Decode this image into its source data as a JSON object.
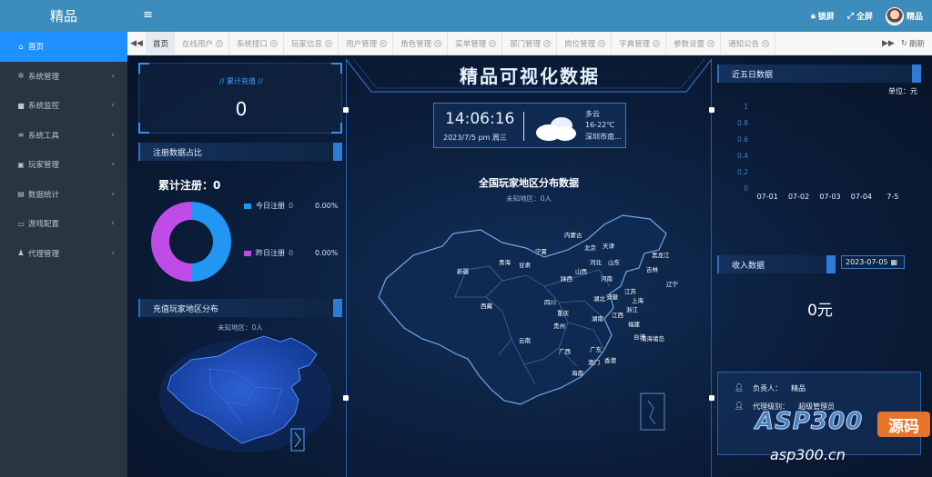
{
  "app": {
    "logo": "精品"
  },
  "sidebar": {
    "items": [
      {
        "icon": "home-icon",
        "glyph": "⌂",
        "label": "首页",
        "active": true,
        "arrow": ""
      },
      {
        "icon": "gear-icon",
        "glyph": "✲",
        "label": "系统管理",
        "active": false,
        "arrow": "‹"
      },
      {
        "icon": "video-icon",
        "glyph": "■",
        "label": "系统监控",
        "active": false,
        "arrow": "‹"
      },
      {
        "icon": "list-icon",
        "glyph": "≡",
        "label": "系统工具",
        "active": false,
        "arrow": "‹"
      },
      {
        "icon": "user-card-icon",
        "glyph": "▣",
        "label": "玩家管理",
        "active": false,
        "arrow": "‹"
      },
      {
        "icon": "chart-icon",
        "glyph": "▤",
        "label": "数据统计",
        "active": false,
        "arrow": "‹"
      },
      {
        "icon": "monitor-icon",
        "glyph": "▭",
        "label": "游戏配置",
        "active": false,
        "arrow": "‹"
      },
      {
        "icon": "agent-icon",
        "glyph": "♟",
        "label": "代理管理",
        "active": false,
        "arrow": "‹"
      }
    ]
  },
  "header": {
    "lock_label": "锁屏",
    "fullscreen_label": "全屏",
    "user_name": "精品"
  },
  "tabs": {
    "items": [
      {
        "label": "首页",
        "active": true,
        "closable": false
      },
      {
        "label": "在线用户",
        "active": false,
        "closable": true
      },
      {
        "label": "系统接口",
        "active": false,
        "closable": true
      },
      {
        "label": "玩家信息",
        "active": false,
        "closable": true
      },
      {
        "label": "用户管理",
        "active": false,
        "closable": true
      },
      {
        "label": "角色管理",
        "active": false,
        "closable": true
      },
      {
        "label": "菜单管理",
        "active": false,
        "closable": true
      },
      {
        "label": "部门管理",
        "active": false,
        "closable": true
      },
      {
        "label": "岗位管理",
        "active": false,
        "closable": true
      },
      {
        "label": "字典管理",
        "active": false,
        "closable": true
      },
      {
        "label": "参数设置",
        "active": false,
        "closable": true
      },
      {
        "label": "通知公告",
        "active": false,
        "closable": true
      }
    ],
    "refresh_label": "刷新"
  },
  "dashboard": {
    "title": "精品可视化数据",
    "recharge": {
      "label": "//    累计充值    //",
      "value": "0"
    },
    "registration": {
      "title": "注册数据占比",
      "total": "累计注册：0",
      "today": {
        "label": "今日注册",
        "count": "0",
        "percent": "0.00%",
        "color": "#2196f3"
      },
      "yesterday": {
        "label": "昨日注册",
        "count": "0",
        "percent": "0.00%",
        "color": "#c04ce8"
      }
    },
    "recharge_region": {
      "title": "充值玩家地区分布",
      "unknown": "未知地区：0人"
    },
    "time": {
      "clock": "14:06:16",
      "date": "2023/7/5   pm   周三"
    },
    "weather": {
      "condition": "多云",
      "temp": "16-22℃",
      "city": "深圳市南..."
    },
    "map": {
      "title": "全国玩家地区分布数据",
      "unknown": "未知地区：0人",
      "provinces": [
        "新疆",
        "西藏",
        "青海",
        "甘肃",
        "宁夏",
        "内蒙古",
        "黑龙江",
        "吉林",
        "辽宁",
        "北京",
        "天津",
        "河北",
        "山西",
        "山东",
        "陕西",
        "河南",
        "四川",
        "重庆",
        "湖北",
        "安徽",
        "江苏",
        "上海",
        "浙江",
        "湖南",
        "江西",
        "福建",
        "贵州",
        "云南",
        "广西",
        "广东",
        "台湾",
        "澳门",
        "香港",
        "海南",
        "南海诸岛"
      ]
    },
    "five_day": {
      "title": "近五日数据",
      "unit": "单位：元"
    },
    "income": {
      "title": "收入数据",
      "date": "2023-07-05",
      "value": "0元"
    },
    "info": {
      "manager_label": "负责人：",
      "manager": "精品",
      "level_label": "代理级别：",
      "level": "超级管理员"
    }
  },
  "chart_data": {
    "type": "bar",
    "title": "近五日数据",
    "categories": [
      "07-01",
      "07-02",
      "07-03",
      "07-04",
      "7-5"
    ],
    "values": [
      0,
      0,
      0,
      0,
      0
    ],
    "yticks": [
      "0",
      "0.2",
      "0.4",
      "0.6",
      "0.8",
      "1"
    ],
    "ylim": [
      0,
      1
    ],
    "ylabel": "单位：元"
  },
  "watermark": {
    "text": "ASP300",
    "badge": "源码",
    "url": "asp300.cn"
  }
}
